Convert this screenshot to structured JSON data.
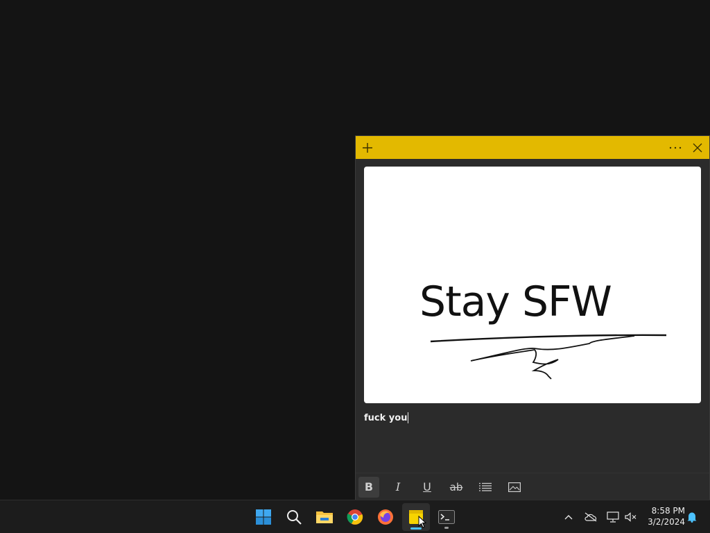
{
  "note": {
    "image_text": "Stay SFW",
    "body_text": "fuck you"
  },
  "clock": {
    "time": "8:58 PM",
    "date": "3/2/2024"
  },
  "colors": {
    "note_header": "#e3b900",
    "note_body": "#2b2b2b",
    "taskbar": "#1c1c1c",
    "accent": "#4cc2ff"
  },
  "icons": {
    "header": [
      "add-icon",
      "more-icon",
      "close-icon"
    ],
    "toolbar": [
      "bold-icon",
      "italic-icon",
      "underline-icon",
      "strikethrough-icon",
      "bullet-list-icon",
      "image-icon"
    ],
    "taskbar": [
      "start-icon",
      "search-icon",
      "file-explorer-icon",
      "chrome-icon",
      "firefox-icon",
      "sticky-notes-icon",
      "terminal-icon"
    ],
    "tray": [
      "chevron-up-icon",
      "onedrive-offline-icon",
      "network-icon",
      "volume-muted-icon",
      "notification-bell-icon"
    ]
  }
}
